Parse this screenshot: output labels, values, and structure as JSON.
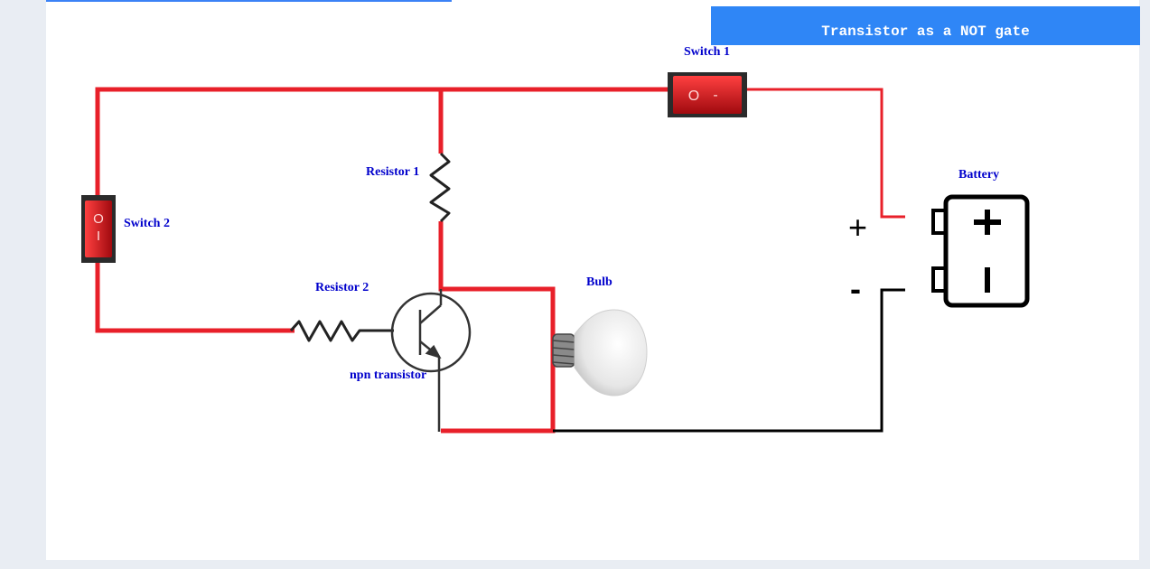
{
  "title": "Transistor as a NOT gate",
  "labels": {
    "switch1": "Switch 1",
    "switch2": "Switch 2",
    "resistor1": "Resistor 1",
    "resistor2": "Resistor 2",
    "transistor": "npn transistor",
    "bulb": "Bulb",
    "battery": "Battery",
    "plus": "+",
    "minus": "-"
  },
  "switch_glyphs": {
    "on": "O",
    "off": "-"
  },
  "colors": {
    "wire_red": "#e8202a",
    "wire_black": "#000000",
    "label_blue": "#0000cc",
    "banner": "#2f86f6",
    "switch_red": "#d0161c"
  }
}
